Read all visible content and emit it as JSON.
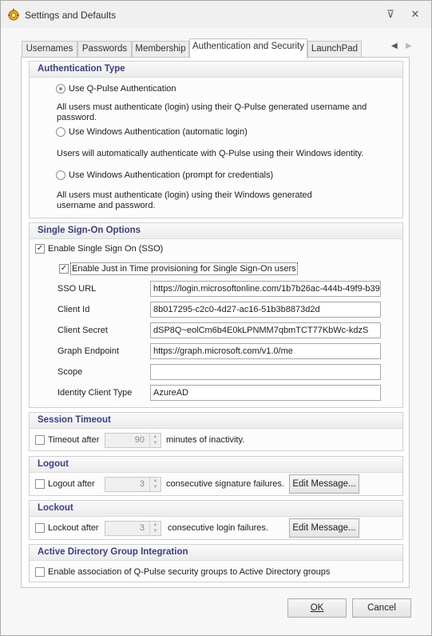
{
  "window": {
    "title": "Settings and Defaults",
    "pin_glyph": "⊽",
    "close_glyph": "✕"
  },
  "tabs": [
    {
      "label": "Usernames"
    },
    {
      "label": "Passwords"
    },
    {
      "label": "Membership"
    },
    {
      "label": "Authentication and Security"
    },
    {
      "label": "LaunchPad"
    }
  ],
  "tab_nav": {
    "prev_glyph": "◀",
    "next_glyph": "▶"
  },
  "auth_type": {
    "heading": "Authentication Type",
    "options": [
      {
        "label": "Use Q-Pulse Authentication",
        "selected": true,
        "description": "All users must authenticate (login) using their Q-Pulse generated username and password."
      },
      {
        "label": "Use Windows Authentication (automatic login)",
        "selected": false,
        "description": "Users will automatically authenticate with Q-Pulse using their Windows  identity."
      },
      {
        "label": "Use Windows Authentication (prompt for credentials)",
        "selected": false,
        "description": "All users must authenticate (login) using their Windows generated username and password."
      }
    ]
  },
  "sso": {
    "heading": "Single Sign-On Options",
    "enable_label": "Enable Single Sign On (SSO)",
    "enable_checked": true,
    "jit_label": "Enable Just in Time provisioning for Single Sign-On users",
    "jit_checked": true,
    "check_glyph": "✓",
    "fields": [
      {
        "label": "SSO URL",
        "value": "https://login.microsoftonline.com/1b7b26ac-444b-49f9-b39"
      },
      {
        "label": "Client Id",
        "value": "8b017295-c2c0-4d27-ac16-51b3b8873d2d"
      },
      {
        "label": "Client Secret",
        "value": "dSP8Q~eolCm6b4E0kLPNMM7qbmTCT77KbWc-kdzS"
      },
      {
        "label": "Graph Endpoint",
        "value": "https://graph.microsoft.com/v1.0/me"
      },
      {
        "label": "Scope",
        "value": ""
      },
      {
        "label": "Identity Client Type",
        "value": "AzureAD"
      }
    ]
  },
  "session_timeout": {
    "heading": "Session Timeout",
    "check_label": "Timeout after",
    "value": "90",
    "suffix": "minutes of inactivity."
  },
  "logout": {
    "heading": "Logout",
    "check_label": "Logout after",
    "value": "3",
    "suffix": "consecutive signature failures.",
    "button": "Edit Message..."
  },
  "lockout": {
    "heading": "Lockout",
    "check_label": "Lockout after",
    "value": "3",
    "suffix": "consecutive login failures.",
    "button": "Edit Message..."
  },
  "ad_group": {
    "heading": "Active Directory Group Integration",
    "check_label": "Enable association of Q-Pulse security groups to Active Directory groups"
  },
  "spin_glyphs": {
    "up": "▲",
    "down": "▼"
  },
  "footer": {
    "ok": "OK",
    "cancel": "Cancel"
  }
}
